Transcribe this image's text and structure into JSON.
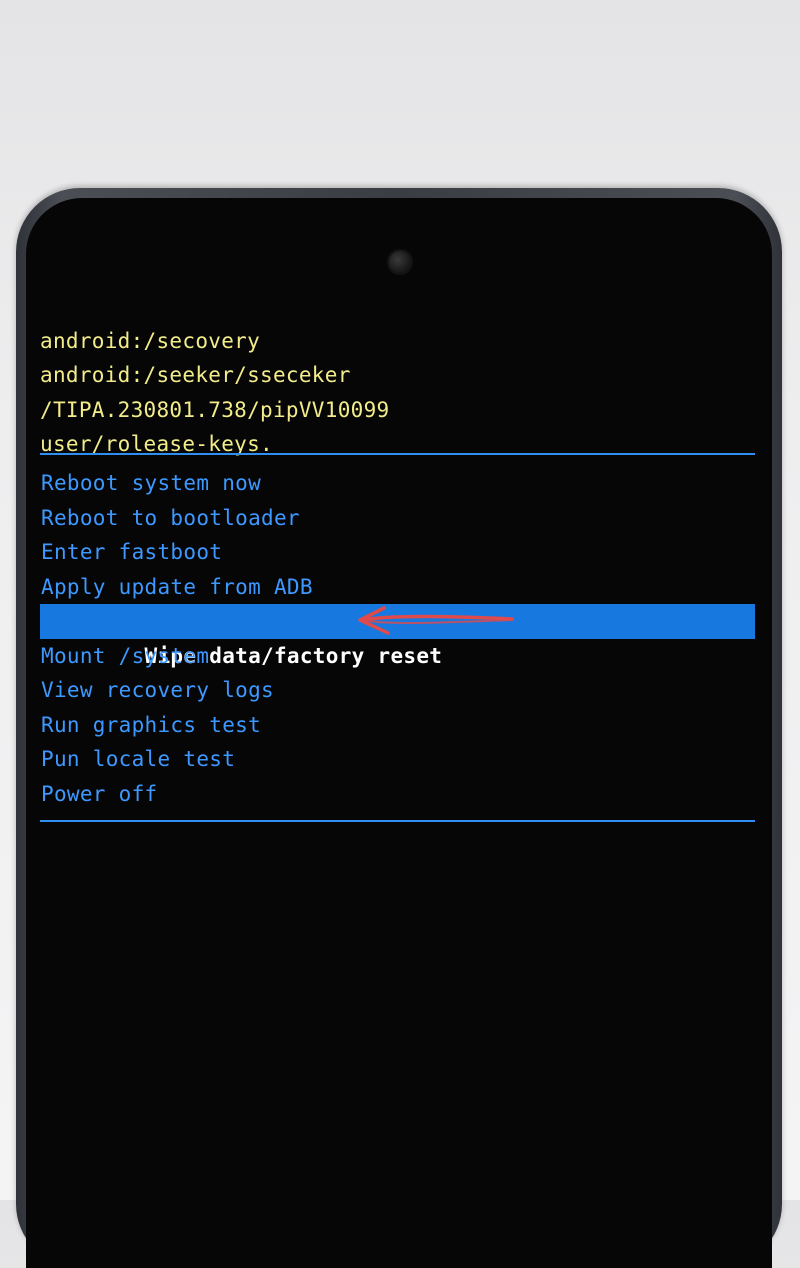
{
  "device": {
    "camera_icon": "front-camera-icon"
  },
  "recovery": {
    "header_lines": [
      "android:/secovery",
      "android:/seeker/sseceker",
      "/TIPA.230801.738/pipVV10099",
      "user/rolease-keys."
    ],
    "menu_items": [
      "Reboot system now",
      "Reboot to bootloader",
      "Enter fastboot",
      "Apply update from ADB",
      "Wipe data/factory reset",
      "Mount /system",
      "View recovery logs",
      "Run graphics test",
      "Pun locale test",
      "Power off"
    ],
    "selected_index": 4
  },
  "colors": {
    "header_text": "#f3ec8a",
    "menu_text": "#3d98ff",
    "highlight": "#1778e0",
    "divider": "#2e8ff0",
    "annotation": "#e04a4a"
  },
  "annotation": {
    "icon": "red-arrow-icon",
    "points_to": "Wipe data/factory reset"
  }
}
